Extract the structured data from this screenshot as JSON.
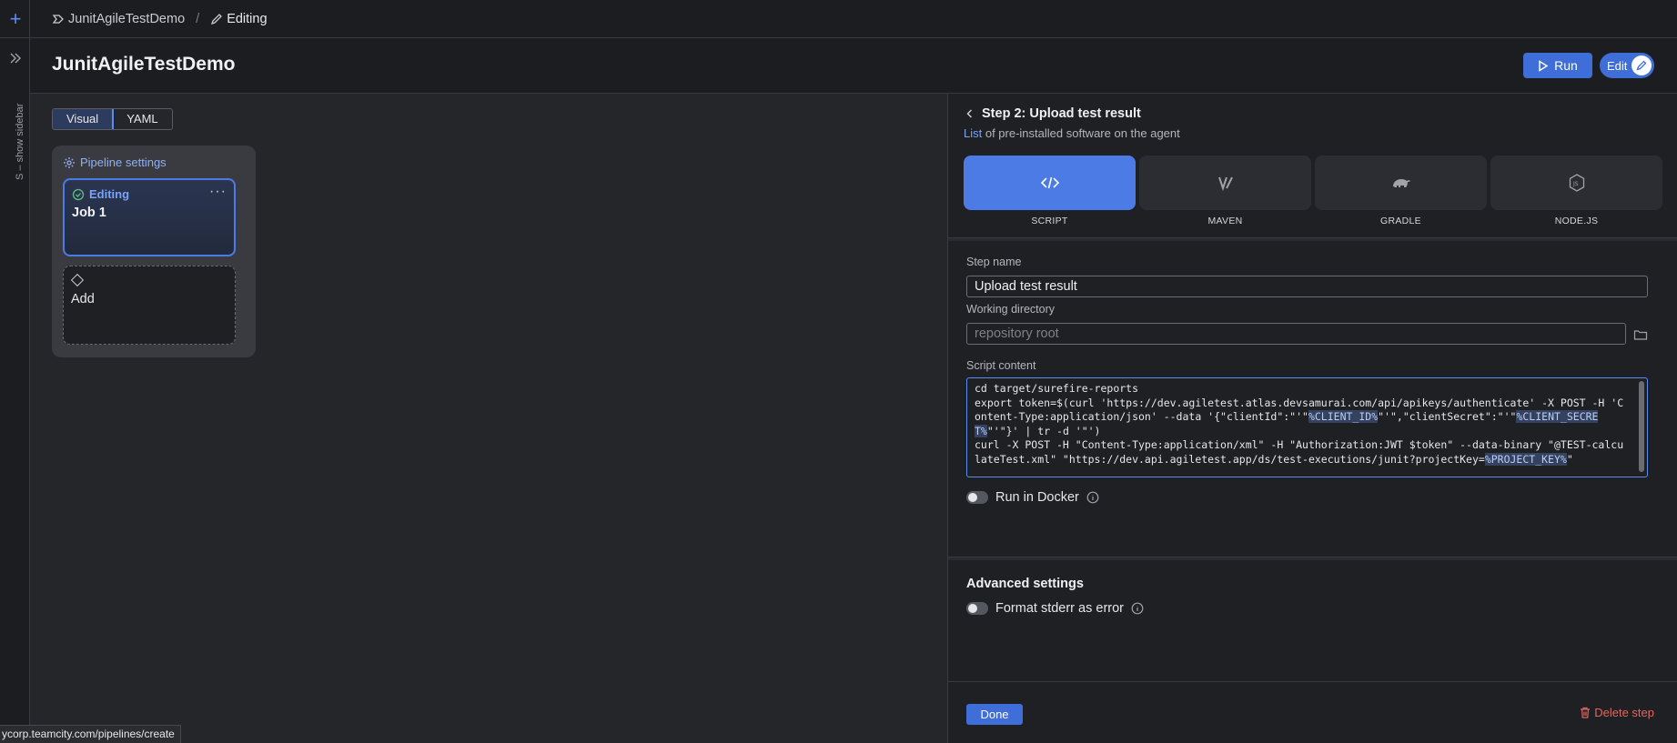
{
  "sidebar": {
    "show_label": "S – show sidebar"
  },
  "breadcrumb": {
    "project": "JunitAgileTestDemo",
    "separator": "/",
    "current": "Editing"
  },
  "header": {
    "title": "JunitAgileTestDemo",
    "run_label": "Run",
    "edit_label": "Edit"
  },
  "canvas": {
    "view_tabs": [
      "Visual",
      "YAML"
    ],
    "active_view": "Visual",
    "pipeline_settings_label": "Pipeline settings",
    "job": {
      "status": "Editing",
      "more": "···",
      "name": "Job 1"
    },
    "add_label": "Add"
  },
  "step": {
    "title": "Step 2: Upload test result",
    "subtitle_link": "List",
    "subtitle_rest": " of pre-installed software on the agent",
    "runners": [
      {
        "label": "SCRIPT",
        "icon": "code-icon",
        "selected": true
      },
      {
        "label": "MAVEN",
        "icon": "maven-icon",
        "selected": false
      },
      {
        "label": "GRADLE",
        "icon": "gradle-icon",
        "selected": false
      },
      {
        "label": "NODE.JS",
        "icon": "nodejs-icon",
        "selected": false
      }
    ],
    "step_name_label": "Step name",
    "step_name_value": "Upload test result",
    "working_dir_label": "Working directory",
    "working_dir_placeholder": "repository root",
    "script_label": "Script content",
    "script_lines": {
      "l1": "cd target/surefire-reports",
      "l2a": "export token=$(curl 'https://dev.agiletest.atlas.devsamurai.com/api/apikeys/authenticate' -X POST -H 'Content-Type:application/json' --data '{\"clientId\":\"'\"",
      "l2_param1": "%CLIENT_ID%",
      "l2b": "\"'\",\"clientSecret\":\"'\"",
      "l2_param2": "%CLIENT_SECRET%",
      "l2c": "\"'\"}' | tr -d '\"')",
      "l3a": "curl -X POST -H \"Content-Type:application/xml\" -H \"Authorization:JWT $token\" --data-binary \"@TEST-calculateTest.xml\" \"https://dev.api.agiletest.app/ds/test-executions/junit?projectKey=",
      "l3_param": "%PROJECT_KEY%",
      "l3b": "\""
    },
    "run_in_docker_label": "Run in Docker",
    "advanced_title": "Advanced settings",
    "format_stderr_label": "Format stderr as error",
    "done_label": "Done",
    "delete_label": "Delete step"
  },
  "status_url": "ycorp.teamcity.com/pipelines/create",
  "colors": {
    "accent": "#3f6ed8",
    "danger": "#e0675f"
  }
}
